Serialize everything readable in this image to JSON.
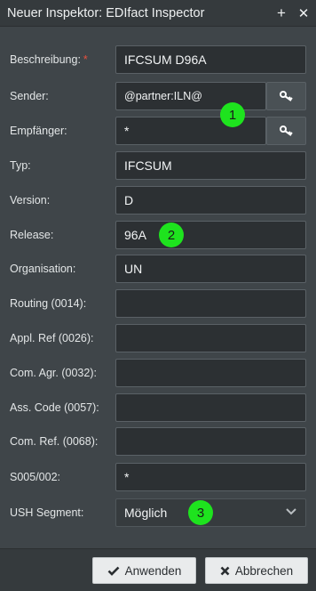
{
  "window": {
    "title": "Neuer Inspektor: EDIfact Inspector",
    "add_symbol": "+",
    "close_symbol": "✕"
  },
  "fields": {
    "beschreibung": {
      "label": "Beschreibung:",
      "required_marker": "*",
      "value": "IFCSUM D96A"
    },
    "sender": {
      "label": "Sender:",
      "value": "@partner:ILN@",
      "trigger_icon": "key-icon"
    },
    "empfaenger": {
      "label": "Empfänger:",
      "value": "*",
      "trigger_icon": "key-icon"
    },
    "typ": {
      "label": "Typ:",
      "value": "IFCSUM"
    },
    "version": {
      "label": "Version:",
      "value": "D"
    },
    "release": {
      "label": "Release:",
      "value": "96A"
    },
    "organisation": {
      "label": "Organisation:",
      "value": "UN"
    },
    "routing": {
      "label": "Routing (0014):",
      "value": ""
    },
    "appl_ref": {
      "label": "Appl. Ref (0026):",
      "value": ""
    },
    "com_agr": {
      "label": "Com. Agr. (0032):",
      "value": ""
    },
    "ass_code": {
      "label": "Ass. Code (0057):",
      "value": ""
    },
    "com_ref": {
      "label": "Com. Ref. (0068):",
      "value": ""
    },
    "s005": {
      "label": "S005/002:",
      "value": "*"
    },
    "ush_segment": {
      "label": "USH Segment:",
      "value": "Möglich",
      "icon": "chevron-down-icon"
    }
  },
  "markers": [
    "1",
    "2",
    "3"
  ],
  "footer": {
    "apply_label": "Anwenden",
    "cancel_label": "Abbrechen"
  },
  "colors": {
    "background": "#3f4549",
    "field_bg": "#2c3033",
    "required": "#e8503e",
    "marker": "#1ee31e",
    "button_bg": "#e9ebec"
  }
}
